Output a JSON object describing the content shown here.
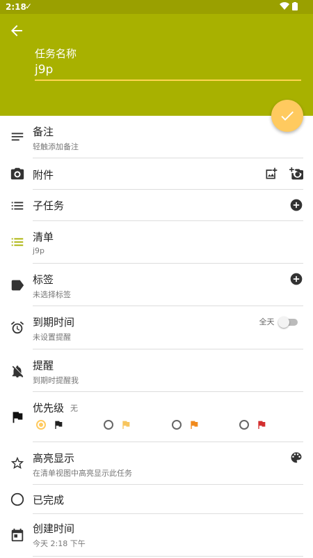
{
  "status_bar": {
    "time": "2:18"
  },
  "header": {
    "field_label": "任务名称",
    "task_name": "j9p"
  },
  "rows": {
    "notes": {
      "title": "备注",
      "sub": "轻触添加备注"
    },
    "attachments": {
      "title": "附件"
    },
    "subtasks": {
      "title": "子任务"
    },
    "list": {
      "title": "清单",
      "sub": "j9p"
    },
    "tags": {
      "title": "标签",
      "sub": "未选择标签"
    },
    "due": {
      "title": "到期时间",
      "sub": "未设置提醒",
      "all_day_label": "全天",
      "all_day_on": false
    },
    "reminder": {
      "title": "提醒",
      "sub": "到期时提醒我"
    },
    "priority": {
      "title": "优先级",
      "value": "无",
      "selected_index": 0,
      "flag_colors": [
        "#212121",
        "#f7c55e",
        "#f08a1c",
        "#d32f2f"
      ]
    },
    "highlight": {
      "title": "高亮显示",
      "sub": "在清单视图中高亮显示此任务"
    },
    "completed": {
      "title": "已完成"
    },
    "created": {
      "title": "创建时间",
      "sub": "今天 2:18 下午"
    }
  },
  "colors": {
    "accent": "#a8b100",
    "fab": "#ffca5f",
    "list_icon": "#a8b100"
  }
}
